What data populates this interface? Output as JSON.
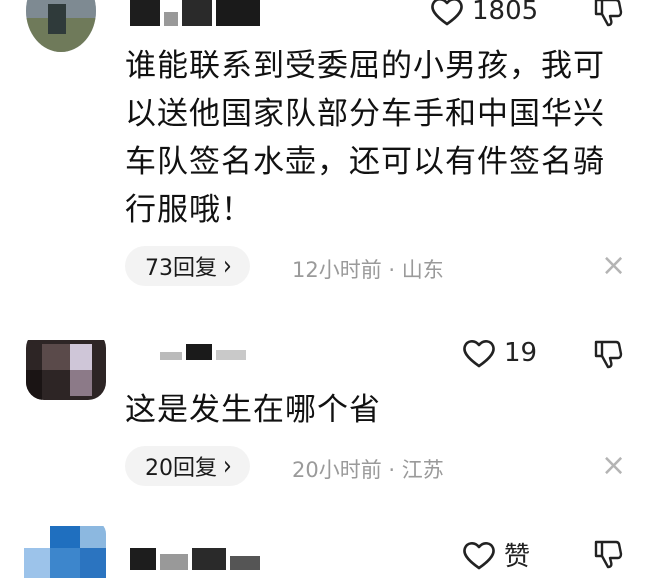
{
  "comments": [
    {
      "likes": "1805",
      "text_lines": [
        "谁能联系到受委屈的小男孩，我可",
        "以送他国家队部分车手和中国华兴",
        "车队签名水壶，还可以有件签名骑",
        "行服哦！"
      ],
      "reply_label": "73回复",
      "time": "12小时前",
      "location": "山东"
    },
    {
      "likes": "19",
      "text_lines": [
        "这是发生在哪个省"
      ],
      "reply_label": "20回复",
      "time": "20小时前",
      "location": "江苏"
    },
    {
      "likes": "赞"
    }
  ],
  "icons": {
    "like": "heart-icon",
    "dislike": "thumbs-down-icon",
    "close": "close-icon",
    "chevron": "chevron-right-icon"
  },
  "glyphs": {
    "chevron": "›",
    "close": "×",
    "meta_separator": "·"
  }
}
